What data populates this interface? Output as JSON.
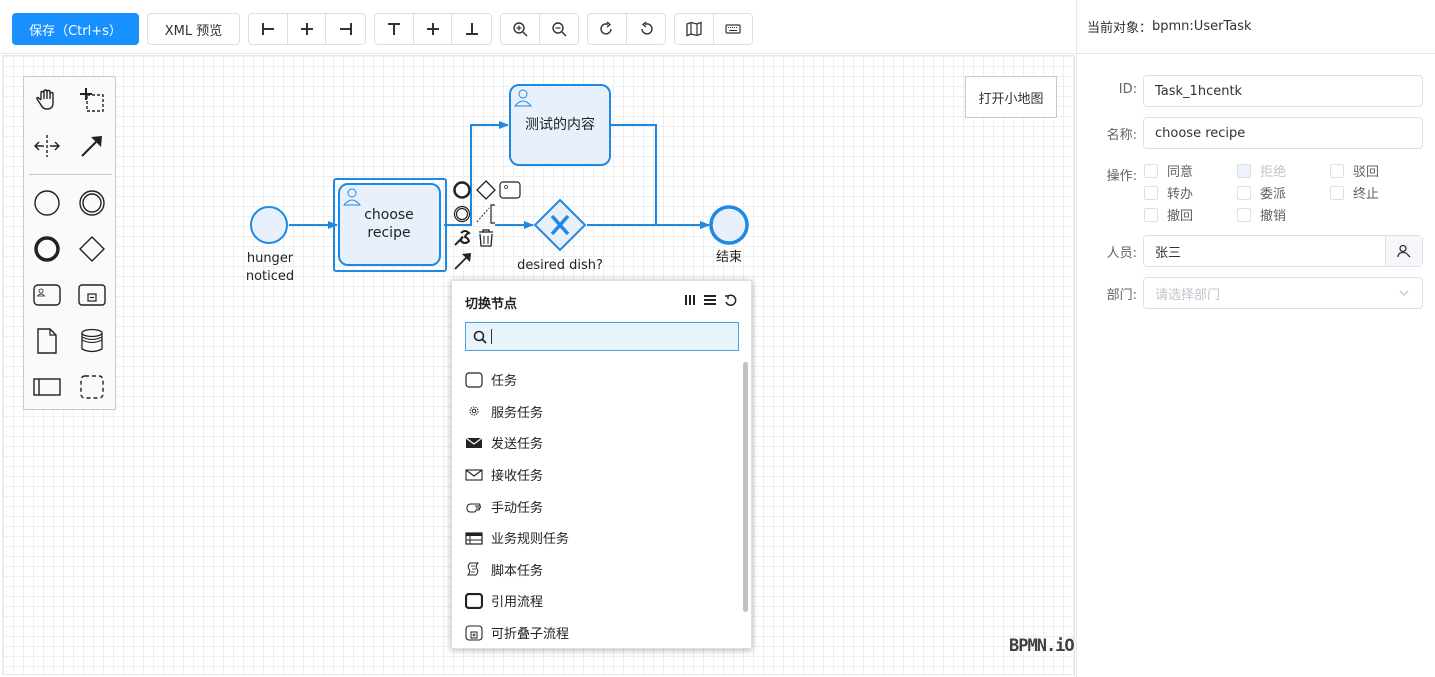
{
  "toolbar": {
    "save_label": "保存（Ctrl+s）",
    "xml_preview_label": "XML 预览",
    "align_group": [
      "align-left-icon",
      "align-center-icon",
      "align-right-icon"
    ],
    "valign_group": [
      "align-top-icon",
      "align-middle-icon",
      "align-bottom-icon"
    ],
    "zoom_group": [
      "zoom-in-icon",
      "zoom-out-icon"
    ],
    "history_group": [
      "redo-icon",
      "undo-icon"
    ],
    "view_group": [
      "map-icon",
      "keyboard-icon"
    ]
  },
  "canvas": {
    "minimap_button": "打开小地图",
    "watermark": "BPMN.iO",
    "palette": [
      "hand-tool-icon",
      "lasso-tool-icon",
      "space-tool-icon",
      "connect-tool-icon",
      "start-event-icon",
      "intermediate-event-icon",
      "end-event-icon",
      "gateway-icon",
      "task-icon",
      "subprocess-icon",
      "data-object-icon",
      "data-store-icon",
      "participant-icon",
      "group-icon"
    ],
    "nodes": {
      "start_label": "hunger noticed",
      "task1_label": "choose recipe",
      "task2_label": "测试的内容",
      "gateway_label": "desired dish?",
      "end_label": "结束"
    }
  },
  "replace_popup": {
    "title": "切换节点",
    "search_value": "",
    "items": [
      {
        "label": "任务",
        "icon": "task-icon"
      },
      {
        "label": "服务任务",
        "icon": "service-task-icon"
      },
      {
        "label": "发送任务",
        "icon": "send-task-icon"
      },
      {
        "label": "接收任务",
        "icon": "receive-task-icon"
      },
      {
        "label": "手动任务",
        "icon": "manual-task-icon"
      },
      {
        "label": "业务规则任务",
        "icon": "business-rule-task-icon"
      },
      {
        "label": "脚本任务",
        "icon": "script-task-icon"
      },
      {
        "label": "引用流程",
        "icon": "call-activity-icon"
      },
      {
        "label": "可折叠子流程",
        "icon": "collapsed-subprocess-icon"
      }
    ]
  },
  "panel": {
    "current_object_label": "当前对象：",
    "current_object_value": "bpmn:UserTask",
    "id_label": "ID:",
    "id_value": "Task_1hcentk",
    "name_label": "名称:",
    "name_value": "choose recipe",
    "ops_label": "操作:",
    "ops": [
      {
        "label": "同意",
        "disabled": false
      },
      {
        "label": "拒绝",
        "disabled": true
      },
      {
        "label": "驳回",
        "disabled": false
      },
      {
        "label": "转办",
        "disabled": false
      },
      {
        "label": "委派",
        "disabled": false
      },
      {
        "label": "终止",
        "disabled": false
      },
      {
        "label": "撤回",
        "disabled": false
      },
      {
        "label": "撤销",
        "disabled": false
      }
    ],
    "person_label": "人员:",
    "person_value": "张三",
    "dept_label": "部门:",
    "dept_placeholder": "请选择部门"
  }
}
